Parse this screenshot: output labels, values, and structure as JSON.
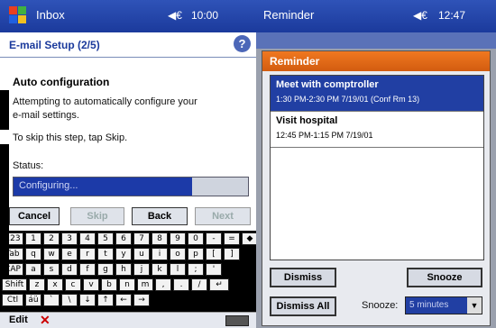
{
  "left": {
    "title": "Inbox",
    "speaker": "◀€",
    "clock": "10:00",
    "subtitle": "E-mail Setup (2/5)",
    "help": "?",
    "heading": "Auto configuration",
    "line1": "Attempting to automatically configure your",
    "line2": "e-mail settings.",
    "line3": "To skip this step, tap Skip.",
    "status_label": "Status:",
    "progress_text": "Configuring...",
    "progress_fraction": 0.76,
    "buttons": {
      "cancel": "Cancel",
      "skip": "Skip",
      "back": "Back",
      "next": "Next"
    },
    "menu_edit": "Edit",
    "menu_x": "✕",
    "keyboard": {
      "row1": [
        "123",
        "1",
        "2",
        "3",
        "4",
        "5",
        "6",
        "7",
        "8",
        "9",
        "0",
        "-",
        "=",
        "◆"
      ],
      "row2": [
        "Tab",
        "q",
        "w",
        "e",
        "r",
        "t",
        "y",
        "u",
        "i",
        "o",
        "p",
        "[",
        "]"
      ],
      "row3": [
        "CAP",
        "a",
        "s",
        "d",
        "f",
        "g",
        "h",
        "j",
        "k",
        "l",
        ";",
        "'"
      ],
      "row4": [
        "Shift",
        "z",
        "x",
        "c",
        "v",
        "b",
        "n",
        "m",
        ",",
        ".",
        "/",
        "↵"
      ],
      "row5": [
        "Ctl",
        "áü",
        "`",
        "\\",
        "↓",
        "↑",
        "←",
        "→"
      ]
    }
  },
  "right": {
    "title": "Reminder",
    "speaker": "◀€",
    "clock": "12:47",
    "dialog_title": "Reminder",
    "items": [
      {
        "title": "Meet with comptroller",
        "time": "1:30 PM-2:30 PM 7/19/01 (Conf Rm 13)"
      },
      {
        "title": "Visit hospital",
        "time": "12:45 PM-1:15 PM 7/19/01"
      }
    ],
    "dismiss": "Dismiss",
    "snooze": "Snooze",
    "dismiss_all": "Dismiss All",
    "snooze_label": "Snooze:",
    "snooze_value": "5 minutes",
    "snooze_arrow": "▼"
  }
}
